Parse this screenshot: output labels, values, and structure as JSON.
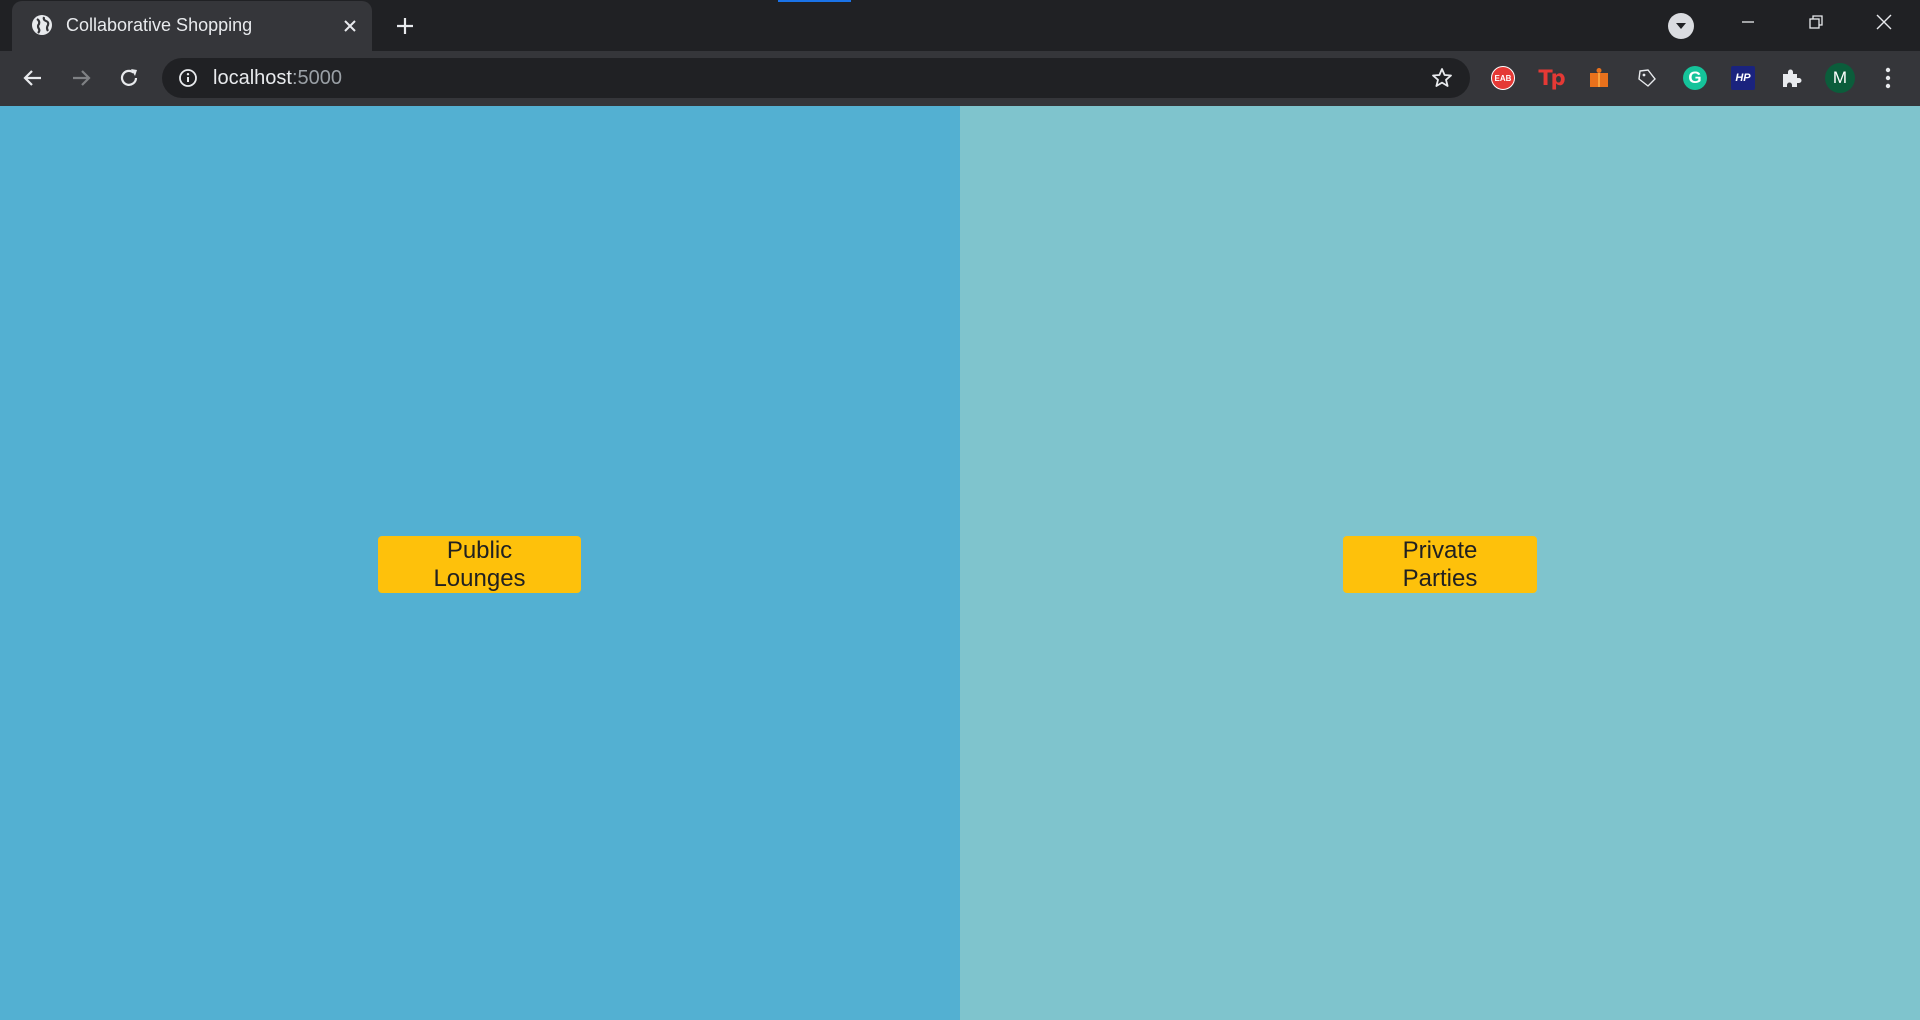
{
  "browser": {
    "tab": {
      "title": "Collaborative Shopping",
      "favicon": "globe-icon"
    },
    "address": {
      "host": "localhost",
      "port": ":5000"
    },
    "avatar_initial": "M",
    "extensions": {
      "eab_label": "EAB",
      "tp_label": "Tp",
      "grammarly_label": "G",
      "hp_label": "HP"
    },
    "accent_color": "#1a73e8"
  },
  "page": {
    "left_panel": {
      "button_label": "Public Lounges",
      "background": "#53b0d2"
    },
    "right_panel": {
      "button_label": "Private Parties",
      "background": "#7fc4cd"
    },
    "button_color": "#fec10b"
  }
}
